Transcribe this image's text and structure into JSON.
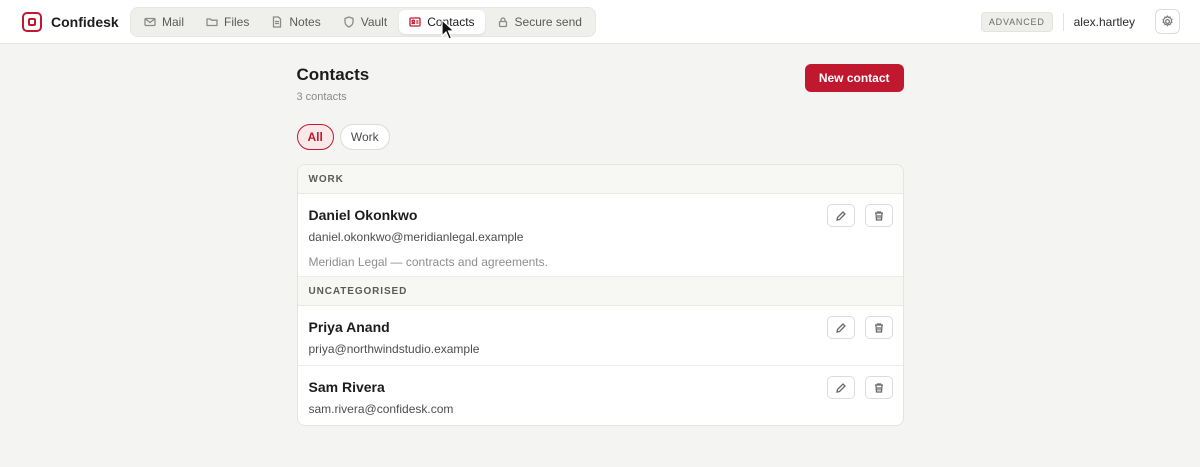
{
  "app": {
    "name": "Confidesk"
  },
  "nav": {
    "tabs": [
      {
        "label": "Mail",
        "icon": "mail-icon"
      },
      {
        "label": "Files",
        "icon": "folder-icon"
      },
      {
        "label": "Notes",
        "icon": "note-icon"
      },
      {
        "label": "Vault",
        "icon": "shield-icon"
      },
      {
        "label": "Contacts",
        "icon": "contact-card-icon",
        "active": true
      },
      {
        "label": "Secure send",
        "icon": "lock-icon"
      }
    ]
  },
  "header": {
    "plan_badge": "ADVANCED",
    "username": "alex.hartley"
  },
  "page": {
    "title": "Contacts",
    "subtitle": "3 contacts",
    "new_button": "New contact"
  },
  "filters": [
    {
      "label": "All",
      "active": true
    },
    {
      "label": "Work",
      "active": false
    }
  ],
  "groups": [
    {
      "label": "WORK",
      "contacts": [
        {
          "name": "Daniel Okonkwo",
          "email": "daniel.okonkwo@meridianlegal.example",
          "note": "Meridian Legal — contracts and agreements."
        }
      ]
    },
    {
      "label": "UNCATEGORISED",
      "contacts": [
        {
          "name": "Priya Anand",
          "email": "priya@northwindstudio.example"
        },
        {
          "name": "Sam Rivera",
          "email": "sam.rivera@confidesk.com"
        }
      ]
    }
  ],
  "colors": {
    "accent": "#c0192f",
    "background": "#f4f4f2"
  }
}
